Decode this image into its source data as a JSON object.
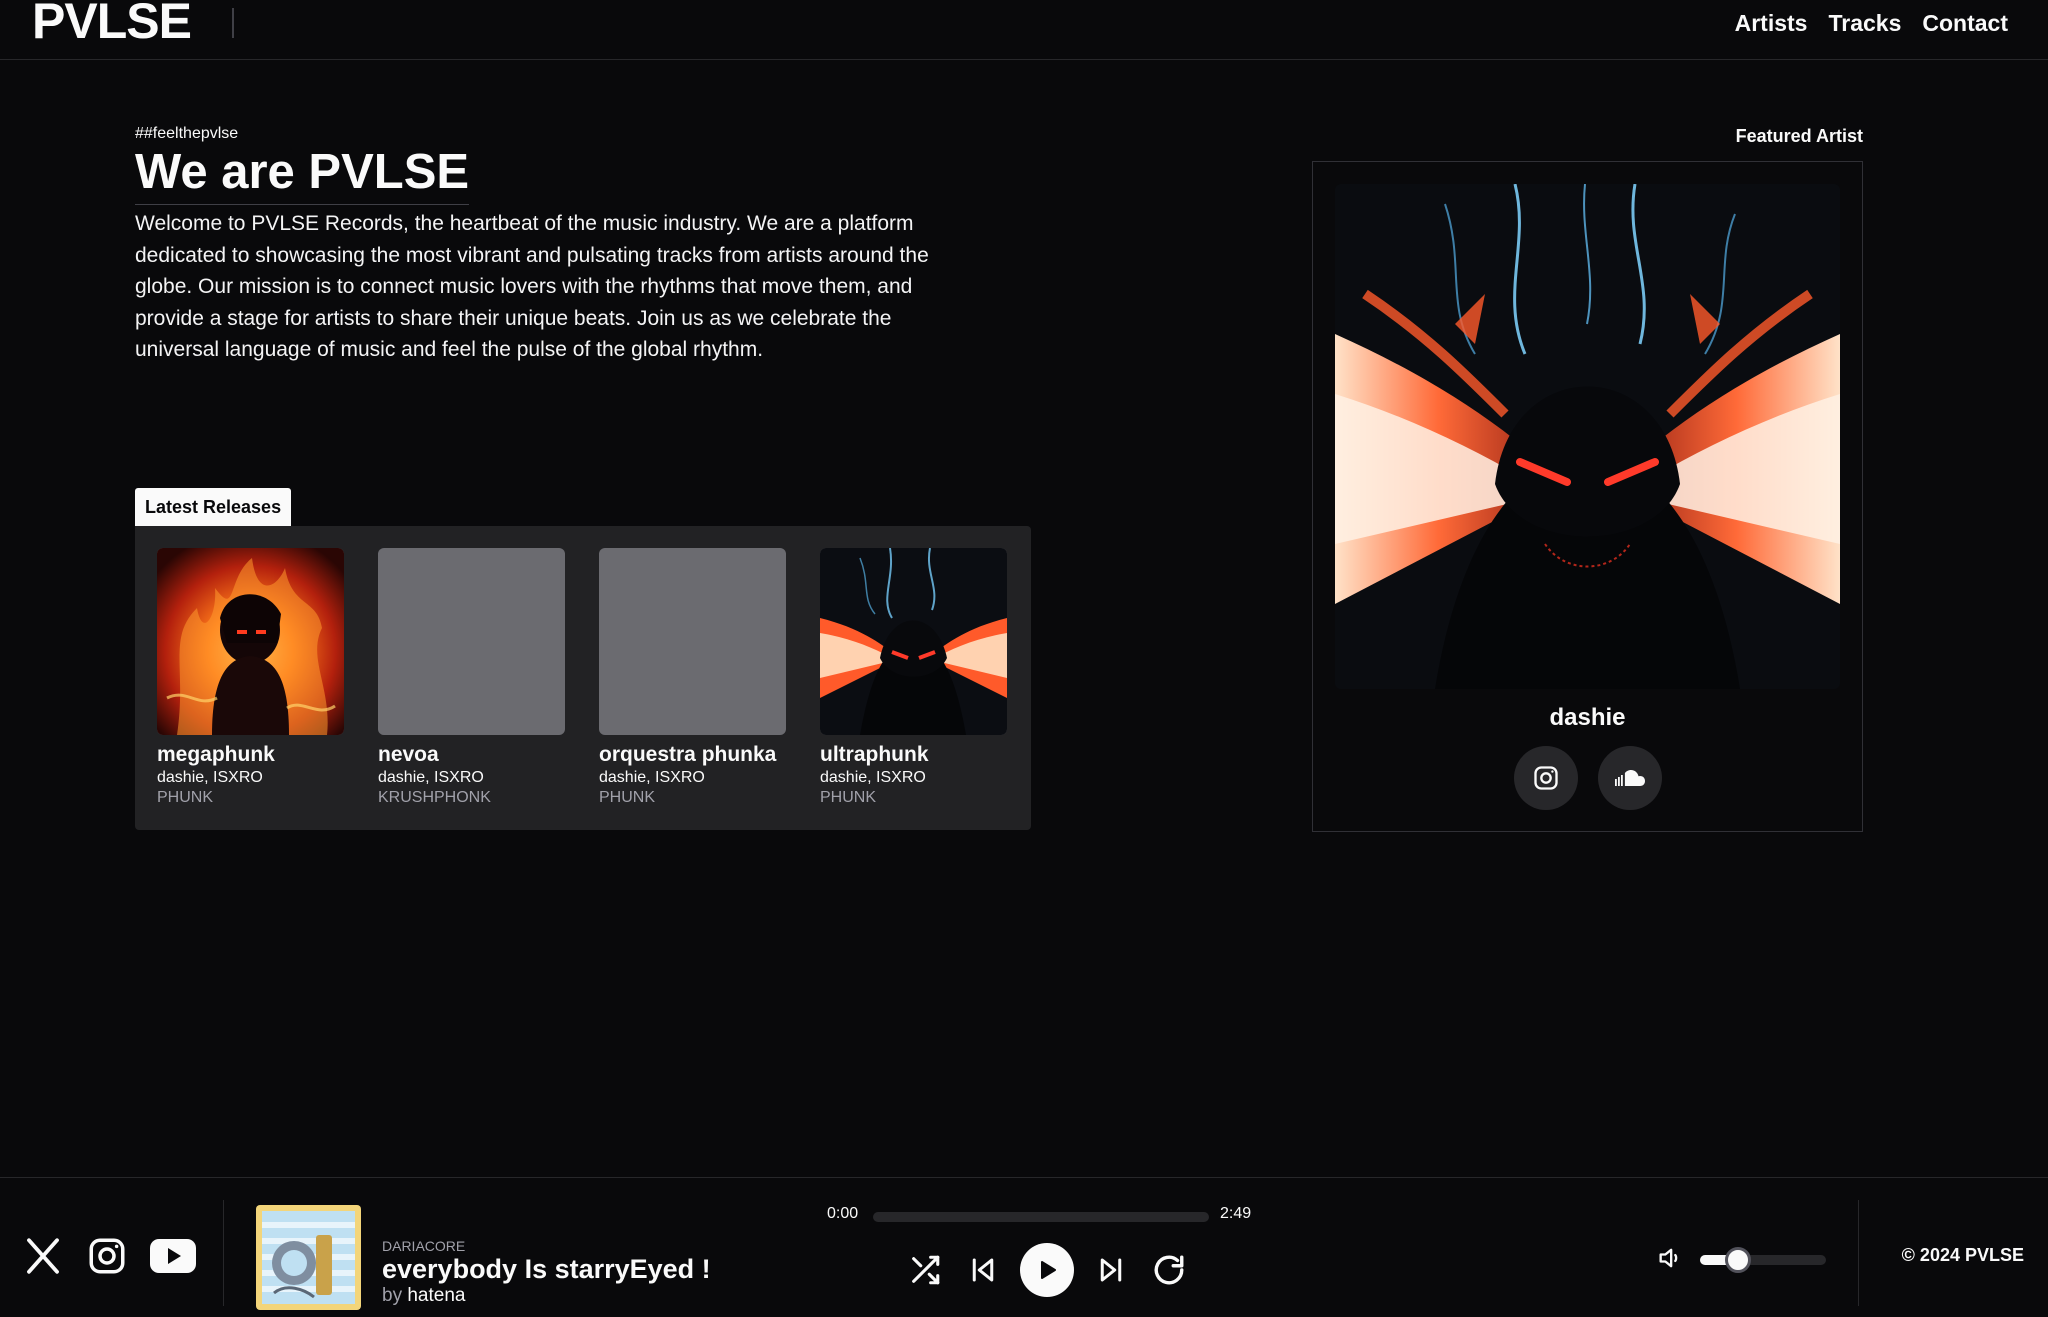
{
  "header": {
    "logo": "PVLSE",
    "nav": [
      "Artists",
      "Tracks",
      "Contact"
    ]
  },
  "hero": {
    "tag": "##feelthepvlse",
    "title_prefix": "We are ",
    "title_brand": "PVLSE",
    "description": "Welcome to PVLSE Records, the heartbeat of the music industry. We are a platform dedicated to showcasing the most vibrant and pulsating tracks from artists around the globe. Our mission is to connect music lovers with the rhythms that move them, and provide a stage for artists to share their unique beats. Join us as we celebrate the universal language of music and feel the pulse of the global rhythm."
  },
  "latest_releases": {
    "label": "Latest Releases",
    "items": [
      {
        "title": "megaphunk",
        "artists": "dashie, ISXRO",
        "genre": "PHUNK",
        "cover": "fire-figure-art"
      },
      {
        "title": "nevoa",
        "artists": "dashie, ISXRO",
        "genre": "KRUSHPHONK",
        "cover": "placeholder"
      },
      {
        "title": "orquestra phunka",
        "artists": "dashie, ISXRO",
        "genre": "PHUNK",
        "cover": "placeholder"
      },
      {
        "title": "ultraphunk",
        "artists": "dashie, ISXRO",
        "genre": "PHUNK",
        "cover": "demon-art"
      }
    ]
  },
  "featured_artist": {
    "label": "Featured Artist",
    "name": "dashie",
    "links": [
      "instagram-icon",
      "soundcloud-icon"
    ]
  },
  "player": {
    "socials": [
      "x-icon",
      "instagram-icon",
      "youtube-icon"
    ],
    "genre": "DARIACORE",
    "title": "everybody Is starryEyed !",
    "by_prefix": "by ",
    "artist": "hatena",
    "current_time": "0:00",
    "duration": "2:49",
    "progress": 0,
    "volume": 0.2,
    "copyright": "© 2024 PVLSE"
  },
  "colors": {
    "background": "#09090b",
    "panel": "#222224",
    "accent": "#fafafa",
    "muted": "#a1a1aa"
  }
}
